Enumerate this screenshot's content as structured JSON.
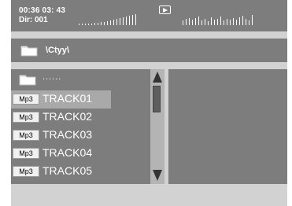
{
  "header": {
    "time": "00:36 03: 43",
    "dir": "Dir: 001",
    "play_icon": "play-icon"
  },
  "path": {
    "folder_icon": "folder-icon",
    "text": "\\Ctyy\\"
  },
  "list": {
    "parent_label": "......",
    "items": [
      {
        "badge": "Mp3",
        "name": "TRACK01",
        "selected": true
      },
      {
        "badge": "Mp3",
        "name": "TRACK02",
        "selected": false
      },
      {
        "badge": "Mp3",
        "name": "TRACK03",
        "selected": false
      },
      {
        "badge": "Mp3",
        "name": "TRACK04",
        "selected": false
      },
      {
        "badge": "Mp3",
        "name": "TRACK05",
        "selected": false
      }
    ]
  },
  "colors": {
    "panel": "#7d7d7d",
    "background": "#d2d2d2",
    "highlight": "#a9a9a9",
    "text": "#ffffff"
  }
}
